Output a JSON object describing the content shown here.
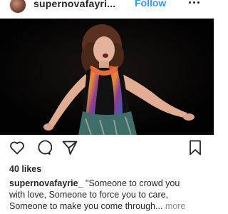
{
  "header": {
    "username": "supernovafayri...",
    "follow_label": "Follow",
    "more_icon": "more-horizontal-icon"
  },
  "photo": {
    "description_icon": "performer-photo",
    "background_color": "#050505"
  },
  "actions": {
    "icons": [
      "heart-icon",
      "comment-icon",
      "share-icon",
      "bookmark-icon"
    ]
  },
  "likes": {
    "text": "40 likes"
  },
  "caption": {
    "username": "supernovafayrie_",
    "text_line1": " \"Someone to crowd you",
    "text_line2": "with love, Someone to force you to care,",
    "text_line3": "Someone to make you come through...",
    "more_label": " more"
  },
  "colors": {
    "accent": "#3897f0",
    "text": "#262626",
    "muted": "#8e8e8e"
  }
}
